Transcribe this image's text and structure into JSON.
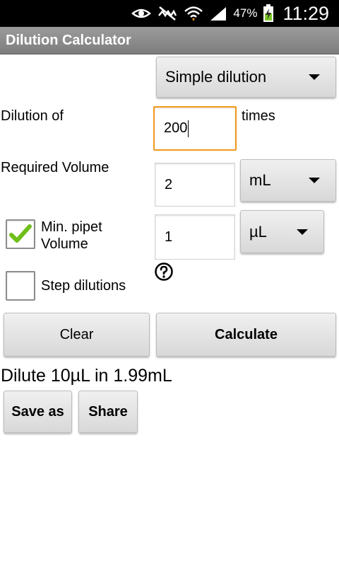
{
  "status_bar": {
    "battery_percent": "47%",
    "time": "11:29",
    "icons": [
      "eye-icon",
      "mute-icon",
      "wifi-icon",
      "signal-icon",
      "battery-charging-icon"
    ]
  },
  "app": {
    "title": "Dilution Calculator"
  },
  "mode_spinner": {
    "selected": "Simple dilution"
  },
  "dilution": {
    "label": "Dilution of",
    "value": "200",
    "suffix": "times"
  },
  "required_volume": {
    "label": "Required Volume",
    "value": "2",
    "unit": "mL"
  },
  "min_pipet": {
    "label_line1": "Min. pipet",
    "label_line2": "Volume",
    "checked": true,
    "value": "1",
    "unit": "µL"
  },
  "step_dilutions": {
    "label": "Step dilutions",
    "checked": false
  },
  "actions": {
    "clear": "Clear",
    "calculate": "Calculate"
  },
  "result": {
    "text": "Dilute 10µL in 1.99mL"
  },
  "result_actions": {
    "save_as": "Save as",
    "share": "Share"
  },
  "colors": {
    "focus_border": "#f39a1c",
    "check_green": "#6fbf1a",
    "title_bar": "#8a8a8a"
  }
}
